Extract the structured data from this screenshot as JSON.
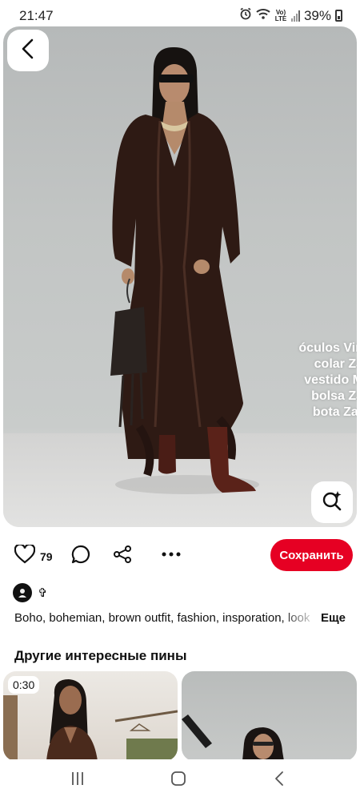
{
  "status_bar": {
    "time": "21:47",
    "lte_label": "Vo) LTE",
    "battery": "39%"
  },
  "pin": {
    "overlay_lines": [
      "óculos Vin",
      "colar Za",
      "vestido M",
      "bolsa Za",
      "bota Zar"
    ],
    "like_count": "79",
    "save_label": "Сохранить",
    "author_name": "✞",
    "description": "Boho, bohemian, brown outfit, fashion, insporation, look",
    "more_label": "Еще"
  },
  "related": {
    "title": "Другие интересные пины",
    "cards": [
      {
        "duration": "0:30"
      },
      {
        "duration": ""
      }
    ]
  },
  "colors": {
    "save_button": "#e60023",
    "dress": "#2e1a14"
  },
  "icons": [
    "back-arrow-icon",
    "visual-search-icon",
    "heart-icon",
    "comment-icon",
    "share-icon",
    "more-icon",
    "alarm-icon",
    "wifi-icon",
    "signal-icon",
    "battery-icon",
    "recents-icon",
    "home-icon",
    "back-icon"
  ]
}
